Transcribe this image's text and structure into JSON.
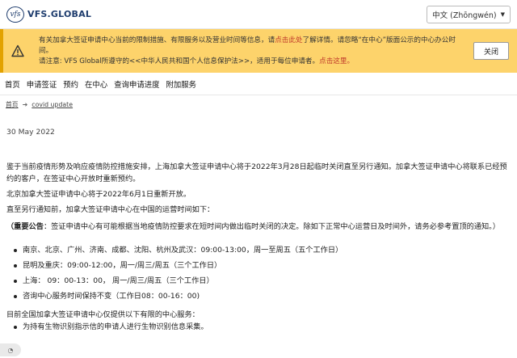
{
  "header": {
    "logo_text": "VFS.GLOBAL",
    "logo_mark": "vfs",
    "language": "中文 (Zhōngwén)"
  },
  "alert": {
    "line1_pre": "有关加拿大签证申请中心当前的限制措施、有限服务以及营业时间等信息，请",
    "line1_link": "点击此处",
    "line1_post": "了解详情。请忽略“在中心”版面公示的中心办公时间。",
    "line2_pre": "请注意: VFS Global所遵守的<<中华人民共和国个人信息保护法>>，适用于每位申请者。",
    "line2_link": "点击这里。",
    "close_label": "关闭",
    "accent_color": "#fdd36b"
  },
  "nav": {
    "items": [
      "首页",
      "申请签证",
      "预约",
      "在中心",
      "查询申请进度",
      "附加服务"
    ]
  },
  "breadcrumb": {
    "home": "首页",
    "current": "covid update"
  },
  "article": {
    "date": "30 May 2022",
    "p1": "鉴于当前疫情形势及响应疫情防控措施安排，上海加拿大签证申请中心将于2022年3月28日起临时关闭直至另行通知。加拿大签证申请中心将联系已经预约的客户，在签证中心开放时重新预约。",
    "p2": "北京加拿大签证申请中心将于2022年6月1日重新开放。",
    "p3": "直至另行通知前，加拿大签证申请中心在中国的运营时间如下：",
    "note_label": "（重要公告",
    "note_text": "：签证申请中心有可能根据当地疫情防控要求在短时间内做出临时关闭的决定。除如下正常中心运营日及时间外，请务必参考置顶的通知。）",
    "bullets": [
      "南京、北京、广州、济南、成都、沈阳、杭州及武汉：09:00-13:00，周一至周五（五个工作日）",
      "昆明及重庆：09:00-12:00，周一/周三/周五（三个工作日）",
      "上海：  09：00-13：00， 周一/周三/周五（三个工作日）",
      "咨询中心服务时间保持不变（工作日08：00-16：00)"
    ],
    "services_intro": "目前全国加拿大签证申请中心仅提供以下有限的中心服务：",
    "services": [
      "为持有生物识别指示信的申请人进行生物识别信息采集。"
    ]
  }
}
